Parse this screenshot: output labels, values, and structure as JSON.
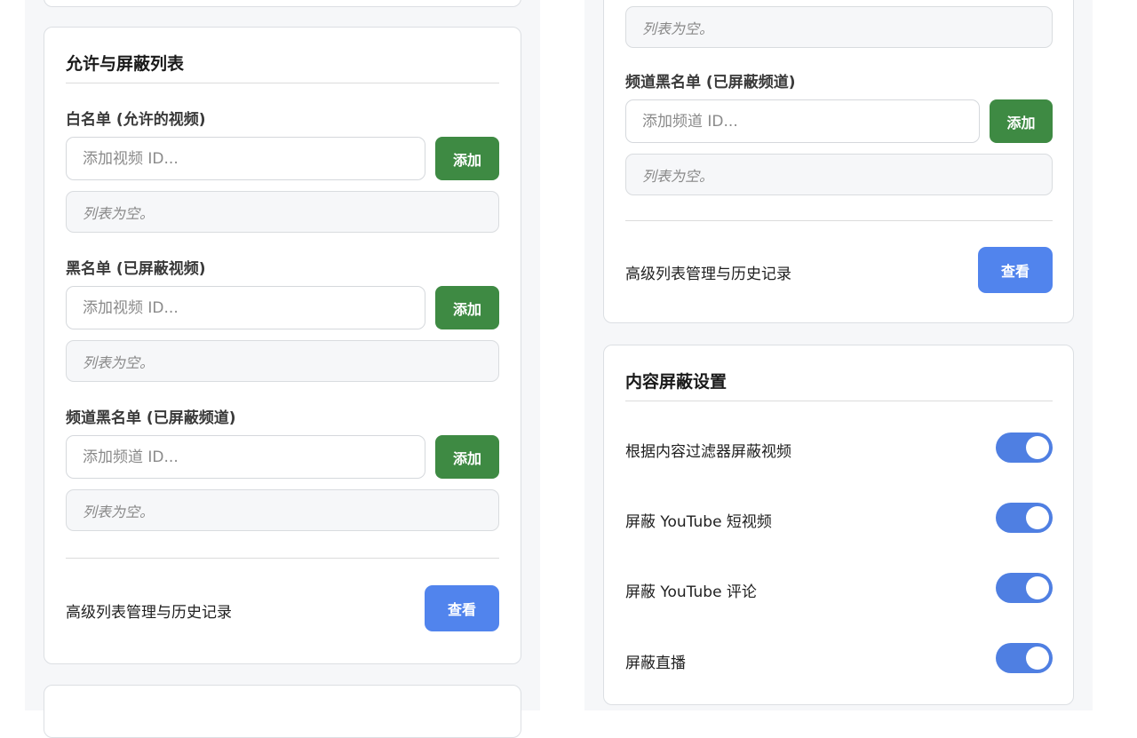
{
  "lists_card": {
    "title": "允许与屏蔽列表",
    "whitelist": {
      "label": "白名单 (允许的视频)",
      "placeholder": "添加视频 ID...",
      "add_label": "添加",
      "empty_text": "列表为空。"
    },
    "blacklist": {
      "label": "黑名单 (已屏蔽视频)",
      "placeholder": "添加视频 ID...",
      "add_label": "添加",
      "empty_text": "列表为空。"
    },
    "channel_blacklist": {
      "label": "频道黑名单 (已屏蔽频道)",
      "placeholder": "添加频道 ID...",
      "add_label": "添加",
      "empty_text": "列表为空。"
    },
    "advanced": {
      "label": "高级列表管理与历史记录",
      "button_label": "查看"
    }
  },
  "lists_card_right": {
    "top_empty_text": "列表为空。",
    "channel_blacklist": {
      "label": "频道黑名单 (已屏蔽频道)",
      "placeholder": "添加频道 ID...",
      "add_label": "添加",
      "empty_text": "列表为空。"
    },
    "advanced": {
      "label": "高级列表管理与历史记录",
      "button_label": "查看"
    }
  },
  "content_blocking": {
    "title": "内容屏蔽设置",
    "toggles": [
      {
        "label": "根据内容过滤器屏蔽视频",
        "enabled": true
      },
      {
        "label": "屏蔽 YouTube 短视频",
        "enabled": true
      },
      {
        "label": "屏蔽 YouTube 评论",
        "enabled": true
      },
      {
        "label": "屏蔽直播",
        "enabled": true
      }
    ]
  },
  "colors": {
    "add_button": "#3e8a43",
    "view_button": "#5184ed",
    "toggle_on": "#4f7fe2"
  }
}
